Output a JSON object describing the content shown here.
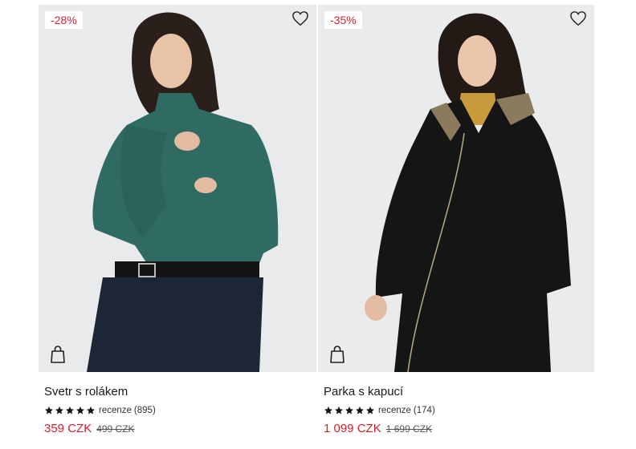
{
  "products": [
    {
      "discount": "-28%",
      "name": "Svetr s rolákem",
      "rating_stars": 5,
      "reviews_label": "recenze",
      "reviews_count": "(895)",
      "price": "359 CZK",
      "old_price": "499 CZK",
      "garment_color": "#2f6b63"
    },
    {
      "discount": "-35%",
      "name": "Parka s kapucí",
      "rating_stars": 5,
      "reviews_label": "recenze",
      "reviews_count": "(174)",
      "price": "1 099 CZK",
      "old_price": "1 699 CZK",
      "garment_color": "#151515"
    }
  ],
  "colors": {
    "sale_red": "#d4202b",
    "text": "#1a1a1a",
    "image_bg": "#e7e9ea"
  },
  "icons": {
    "wishlist": "heart-icon",
    "add_to_cart": "shopping-bag-icon",
    "rating": "star-icon"
  }
}
